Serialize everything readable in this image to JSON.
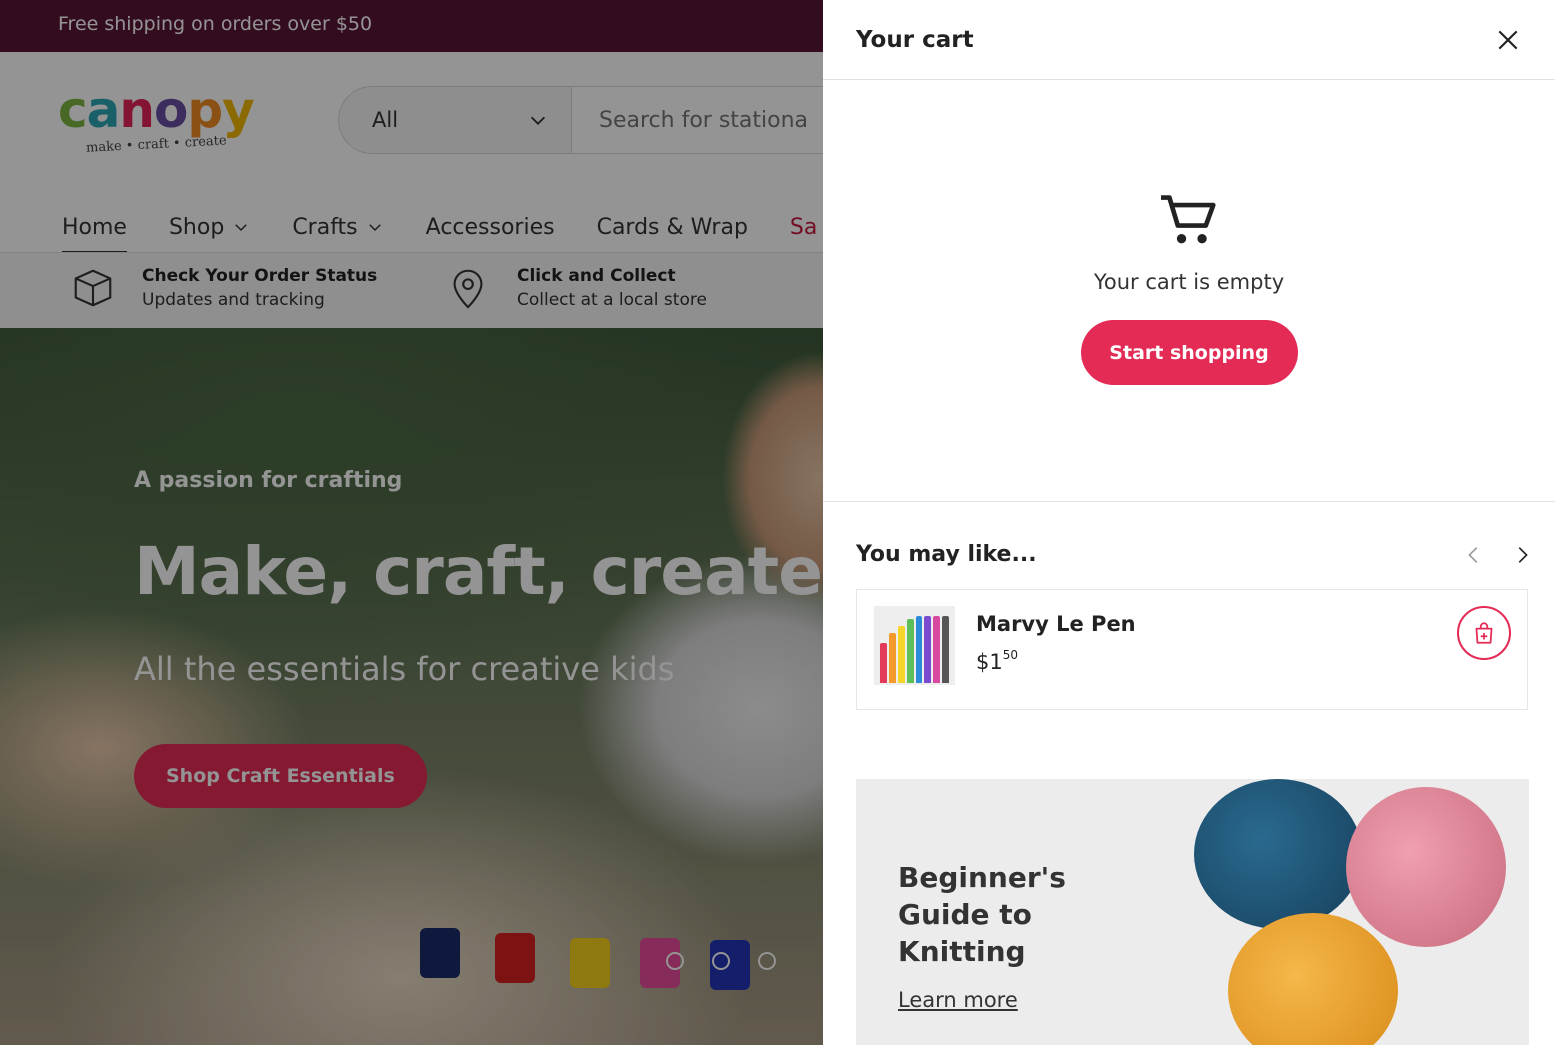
{
  "promo_bar": {
    "text": "Free shipping on orders over $50"
  },
  "logo": {
    "word": [
      "c",
      "a",
      "n",
      "o",
      "p",
      "y"
    ],
    "tagline": "make • craft • create"
  },
  "search": {
    "department": "All",
    "placeholder": "Search for stationa"
  },
  "nav": {
    "items": [
      {
        "label": "Home",
        "active": true
      },
      {
        "label": "Shop",
        "dropdown": true
      },
      {
        "label": "Crafts",
        "dropdown": true
      },
      {
        "label": "Accessories"
      },
      {
        "label": "Cards & Wrap"
      },
      {
        "label": "Sa",
        "accent": "#c4183e"
      }
    ]
  },
  "services": [
    {
      "title": "Check Your Order Status",
      "subtitle": "Updates and tracking",
      "icon": "box-icon"
    },
    {
      "title": "Click and Collect",
      "subtitle": "Collect at a local store",
      "icon": "location-pin-icon"
    }
  ],
  "hero": {
    "kicker": "A passion for crafting",
    "title": "Make, craft, create.",
    "subtitle": "All the essentials for creative kids",
    "button": "Shop Craft Essentials"
  },
  "cart": {
    "title": "Your cart",
    "empty_text": "Your cart is empty",
    "start_button": "Start shopping",
    "icon": "cart-icon"
  },
  "recommendations": {
    "title": "You may like...",
    "product": {
      "name": "Marvy Le Pen",
      "price_dollars": "$1",
      "price_cents": "50"
    }
  },
  "promo_card": {
    "title": "Beginner's Guide to Knitting",
    "link": "Learn more"
  },
  "colors": {
    "accent": "#e32b55",
    "promo_bar": "#5a1537",
    "sale": "#c4183e"
  }
}
